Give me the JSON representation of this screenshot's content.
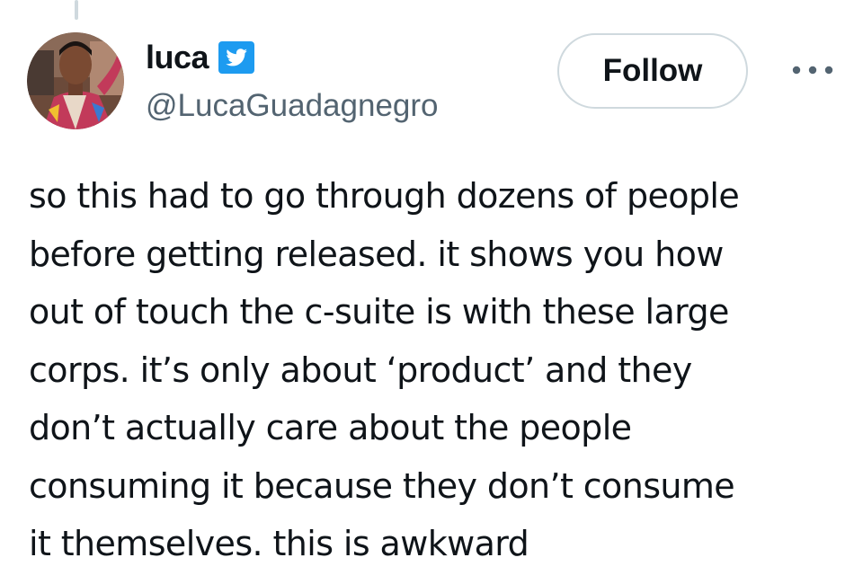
{
  "author": {
    "display_name": "luca",
    "handle": "@LucaGuadagnegro",
    "verified": true
  },
  "actions": {
    "follow_label": "Follow",
    "more_icon": "more-horizontal-icon"
  },
  "tweet": {
    "lines": [
      "so this had to go through dozens of people",
      "before getting released. it shows you how",
      "out of touch the c-suite is with these large",
      "corps. it’s only about ‘product’ and they",
      "don’t actually care about the people",
      "consuming it because they don’t consume",
      "it themselves. this is awkward"
    ]
  },
  "colors": {
    "text_primary": "#0f1419",
    "text_secondary": "#536471",
    "border": "#cfd9de",
    "verified_blue": "#1d9bf0"
  }
}
